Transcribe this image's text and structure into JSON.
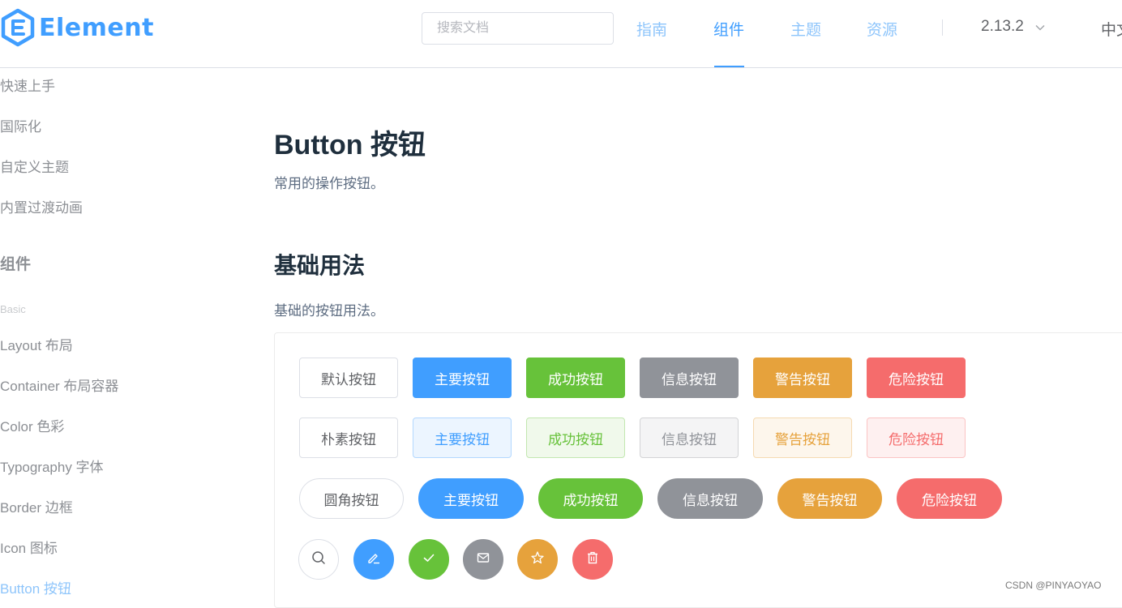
{
  "header": {
    "logo_text": "Element",
    "search_placeholder": "搜索文档",
    "nav": [
      "指南",
      "组件",
      "主题",
      "资源"
    ],
    "active_nav": "组件",
    "version": "2.13.2",
    "lang": "中文"
  },
  "sidebar": {
    "guide_items": [
      "快速上手",
      "国际化",
      "自定义主题",
      "内置过渡动画"
    ],
    "group_title": "组件",
    "sub_title": "Basic",
    "component_items": [
      "Layout 布局",
      "Container 布局容器",
      "Color 色彩",
      "Typography 字体",
      "Border 边框",
      "Icon 图标",
      "Button 按钮"
    ],
    "active_item": "Button 按钮"
  },
  "main": {
    "title": "Button 按钮",
    "desc": "常用的操作按钮。",
    "section_title": "基础用法",
    "section_desc": "基础的按钮用法。",
    "row1": [
      "默认按钮",
      "主要按钮",
      "成功按钮",
      "信息按钮",
      "警告按钮",
      "危险按钮"
    ],
    "row2": [
      "朴素按钮",
      "主要按钮",
      "成功按钮",
      "信息按钮",
      "警告按钮",
      "危险按钮"
    ],
    "row3": [
      "圆角按钮",
      "主要按钮",
      "成功按钮",
      "信息按钮",
      "警告按钮",
      "危险按钮"
    ],
    "row4_icons": [
      "search-icon",
      "edit-icon",
      "check-icon",
      "message-icon",
      "star-icon",
      "delete-icon"
    ]
  },
  "colors": {
    "primary": "#409eff",
    "success": "#67c23a",
    "info": "#909399",
    "warning": "#e6a23c",
    "danger": "#f56c6c"
  },
  "watermark": "CSDN @PINYAOYAO"
}
